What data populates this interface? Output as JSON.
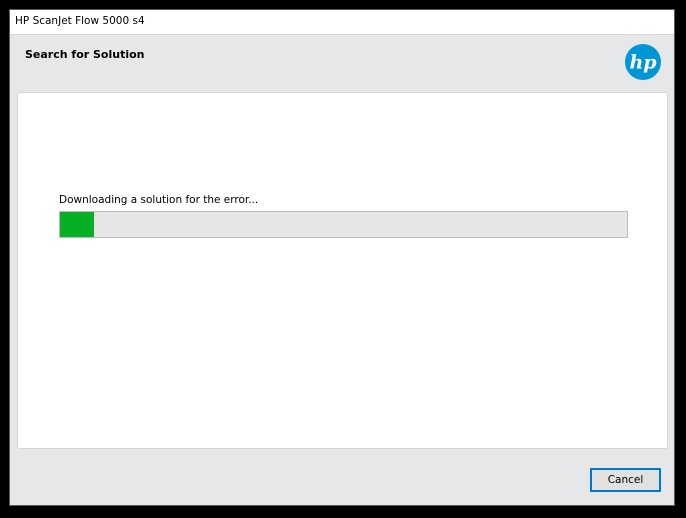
{
  "window": {
    "title": "HP ScanJet Flow 5000 s4"
  },
  "header": {
    "title": "Search for Solution",
    "logo_text": "hp",
    "logo_color": "#0096d6"
  },
  "status": {
    "message": "Downloading a solution for the error..."
  },
  "progress": {
    "value_percent": 6,
    "fill_color": "#06b025"
  },
  "buttons": {
    "cancel_label": "Cancel"
  }
}
